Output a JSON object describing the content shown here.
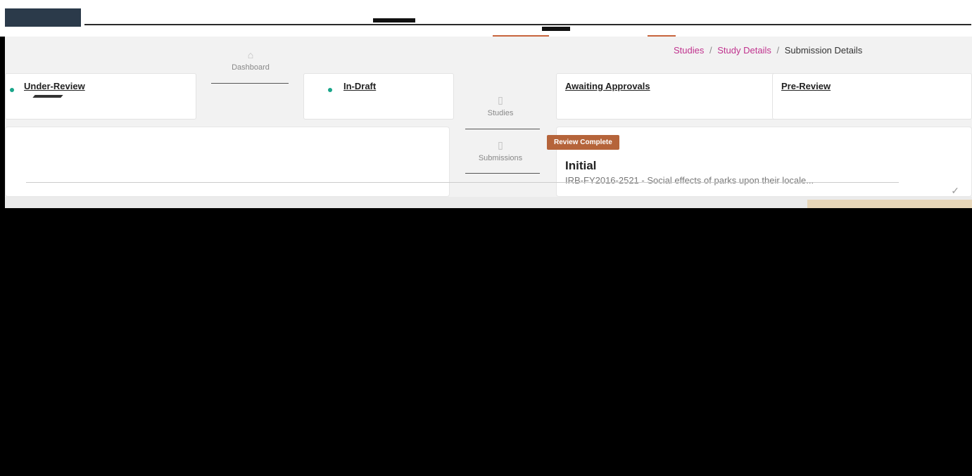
{
  "breadcrumb": {
    "items": [
      "Studies",
      "Study Details"
    ],
    "current": "Submission Details",
    "separator": "/"
  },
  "nav": {
    "dashboard_label": "Dashboard",
    "studies_label": "Studies",
    "submissions_label": "Submissions"
  },
  "status_cards": [
    {
      "title": "Under-Review"
    },
    {
      "title": "In-Draft"
    },
    {
      "title": "Awaiting Approvals"
    },
    {
      "title": "Pre-Review"
    }
  ],
  "submission": {
    "badge": "Review Complete",
    "title": "Initial",
    "description": "IRB-FY2016-2521 - Social effects of parks upon their locale..."
  },
  "colors": {
    "accent": "#c0338e",
    "badge": "#b5643a",
    "status_dot": "#19a58a",
    "header": "#2b3a4a"
  },
  "icons": {
    "dashboard": "home-icon",
    "studies": "book-icon",
    "submissions": "document-icon",
    "check": "check-icon"
  }
}
